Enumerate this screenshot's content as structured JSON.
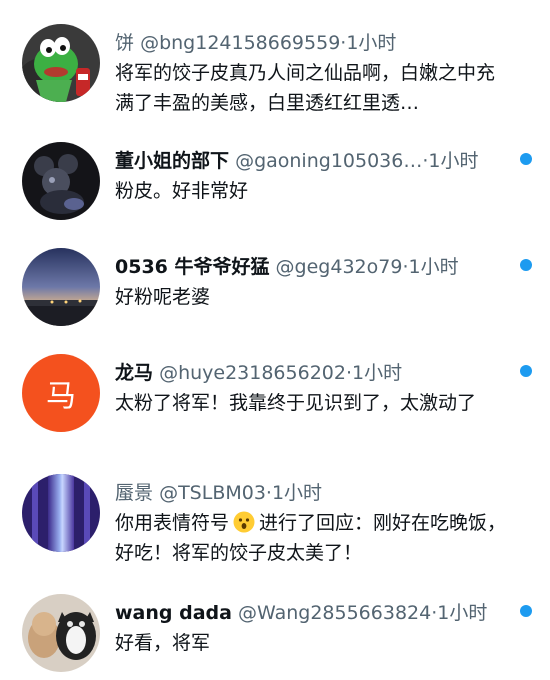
{
  "items": [
    {
      "name": "饼",
      "handle": "@bng124158669559",
      "sep": "·",
      "time": "1小时",
      "text": "将军的饺子皮真乃人间之仙品啊，白嫩之中充满了丰盈的美感，白里透红红里透…",
      "unread": false,
      "avatar_icon": "kermit-frog-avatar"
    },
    {
      "name": "董小姐的部下",
      "handle": "@gaoning105036…",
      "sep": "·",
      "time": "1小时",
      "text": "粉皮。好非常好",
      "unread": true,
      "avatar_icon": "mickey-figure-avatar"
    },
    {
      "name": "0536 牛爷爷好猛",
      "handle": "@geg432o79",
      "sep": "·",
      "time": "1小时",
      "text": "好粉呢老婆",
      "unread": true,
      "avatar_icon": "dusk-sky-avatar"
    },
    {
      "name": "龙马",
      "handle": "@huye2318656202",
      "sep": "·",
      "time": "1小时",
      "text": "太粉了将军！我靠终于见识到了，太激动了",
      "unread": true,
      "avatar_text": "马",
      "avatar_color": "#f4511e"
    },
    {
      "name": "蜃景",
      "handle": "@TSLBM03",
      "sep": "·",
      "time": "1小时",
      "text_before": "你用表情符号",
      "text_after": "进行了回应：刚好在吃晚饭，好吃！将军的饺子皮太美了！",
      "emoji_icon": "astonished-face-emoji",
      "unread": false,
      "avatar_icon": "light-beam-avatar"
    },
    {
      "name": "wang dada",
      "handle": "@Wang2855663824",
      "sep": "·",
      "time": "1小时",
      "text": "好看，将军",
      "unread": true,
      "avatar_icon": "cats-avatar"
    }
  ],
  "colors": {
    "accent_dot": "#1d9bf0",
    "secondary_text": "#536471",
    "primary_text": "#0f1419"
  }
}
